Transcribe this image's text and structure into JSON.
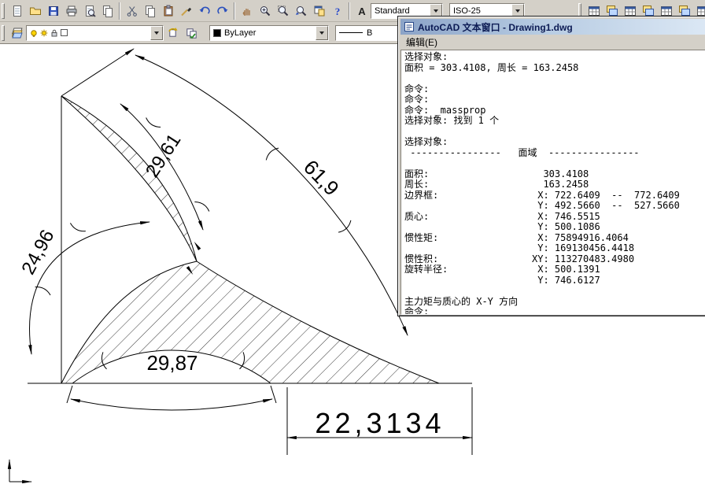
{
  "toolbar_main": {
    "style_value": "Standard",
    "dimstyle_value": "ISO-25",
    "glyphs": {
      "help": "?",
      "text_style": "A"
    },
    "left_icons": [
      "new-drawing",
      "open",
      "save",
      "plot",
      "plot-preview",
      "publish",
      "cut",
      "copy",
      "paste",
      "match-properties",
      "undo",
      "redo",
      "pan-realtime",
      "zoom-realtime",
      "zoom-window",
      "zoom-previous",
      "properties",
      "help"
    ],
    "right_icons": [
      "right-tool-1",
      "right-tool-2",
      "right-tool-3",
      "right-tool-4",
      "right-tool-5",
      "right-tool-6",
      "right-tool-7"
    ]
  },
  "toolbar_layers": {
    "icons": [
      "layer-properties",
      "layer-previous",
      "layer-states"
    ],
    "color_value": "ByLayer",
    "linetype_value": "B"
  },
  "drawing": {
    "dimensions": {
      "arc_left_upper": "29,61",
      "arc_hypotenuse": "61,9",
      "arc_left_lower": "24,96",
      "arc_bottom": "29,87",
      "linear_bottom": "22,3134"
    }
  },
  "text_window": {
    "title": "AutoCAD 文本窗口 - Drawing1.dwg",
    "menu_edit": "编辑(E)",
    "lines": [
      {
        "t": "选择对象:"
      },
      {
        "t": "面积 = 303.4108, 周长 = 163.2458"
      },
      {
        "t": ""
      },
      {
        "t": "命令:"
      },
      {
        "t": "命令:"
      },
      {
        "t": "命令: _massprop"
      },
      {
        "t": "选择对象: 找到 1 个"
      },
      {
        "t": ""
      },
      {
        "t": "选择对象:"
      },
      {
        "t": " ----------------   面域  ----------------"
      },
      {
        "t": ""
      },
      {
        "l": "面积:",
        "v": "  303.4108"
      },
      {
        "l": "周长:",
        "v": "  163.2458"
      },
      {
        "l": "边界框:",
        "v": " X: 722.6409  --  772.6409"
      },
      {
        "l": "",
        "v": " Y: 492.5660  --  527.5660"
      },
      {
        "l": "质心:",
        "v": " X: 746.5515"
      },
      {
        "l": "",
        "v": " Y: 500.1086"
      },
      {
        "l": "惯性矩:",
        "v": " X: 75894916.4064"
      },
      {
        "l": "",
        "v": " Y: 169130456.4418"
      },
      {
        "l": "惯性积:",
        "v": "XY: 113270483.4980"
      },
      {
        "l": "旋转半径:",
        "v": " X: 500.1391"
      },
      {
        "l": "",
        "v": " Y: 746.6127"
      },
      {
        "t": ""
      },
      {
        "t": "主力矩与质心的 X-Y 方向"
      },
      {
        "t": "命令:"
      }
    ]
  }
}
